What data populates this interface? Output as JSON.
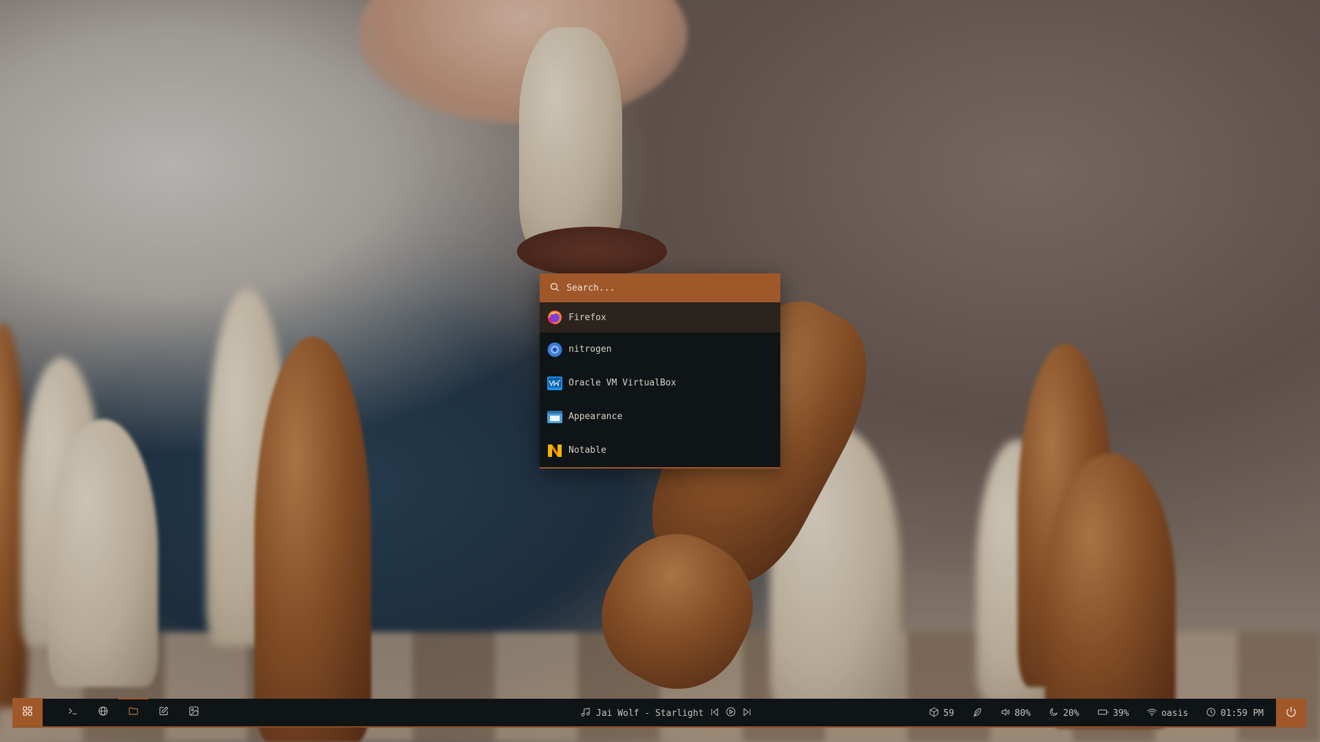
{
  "launcher": {
    "search_placeholder": "Search...",
    "apps": [
      {
        "label": "Firefox",
        "icon": "firefox-icon",
        "selected": true
      },
      {
        "label": "nitrogen",
        "icon": "nitrogen-icon",
        "selected": false
      },
      {
        "label": "Oracle VM VirtualBox",
        "icon": "virtualbox-icon",
        "selected": false
      },
      {
        "label": "Appearance",
        "icon": "appearance-icon",
        "selected": false
      },
      {
        "label": "Notable",
        "icon": "notable-icon",
        "selected": false
      }
    ]
  },
  "taskbar": {
    "start_icon": "grid-icon",
    "launchers": [
      {
        "icon": "terminal-icon"
      },
      {
        "icon": "globe-icon"
      },
      {
        "icon": "folder-icon",
        "active": true
      },
      {
        "icon": "edit-icon"
      },
      {
        "icon": "image-icon"
      }
    ],
    "media": {
      "track": "Jai Wolf - Starlight"
    },
    "status": {
      "packages": "59",
      "volume": "80%",
      "night_light": "20%",
      "battery": "39%",
      "wifi": "oasis",
      "time": "01:59 PM"
    },
    "power_icon": "power-icon"
  },
  "colors": {
    "accent": "#a0582a",
    "panel_bg": "#0f1417",
    "selected_bg": "#2b231d",
    "text": "#c9c3b8"
  }
}
